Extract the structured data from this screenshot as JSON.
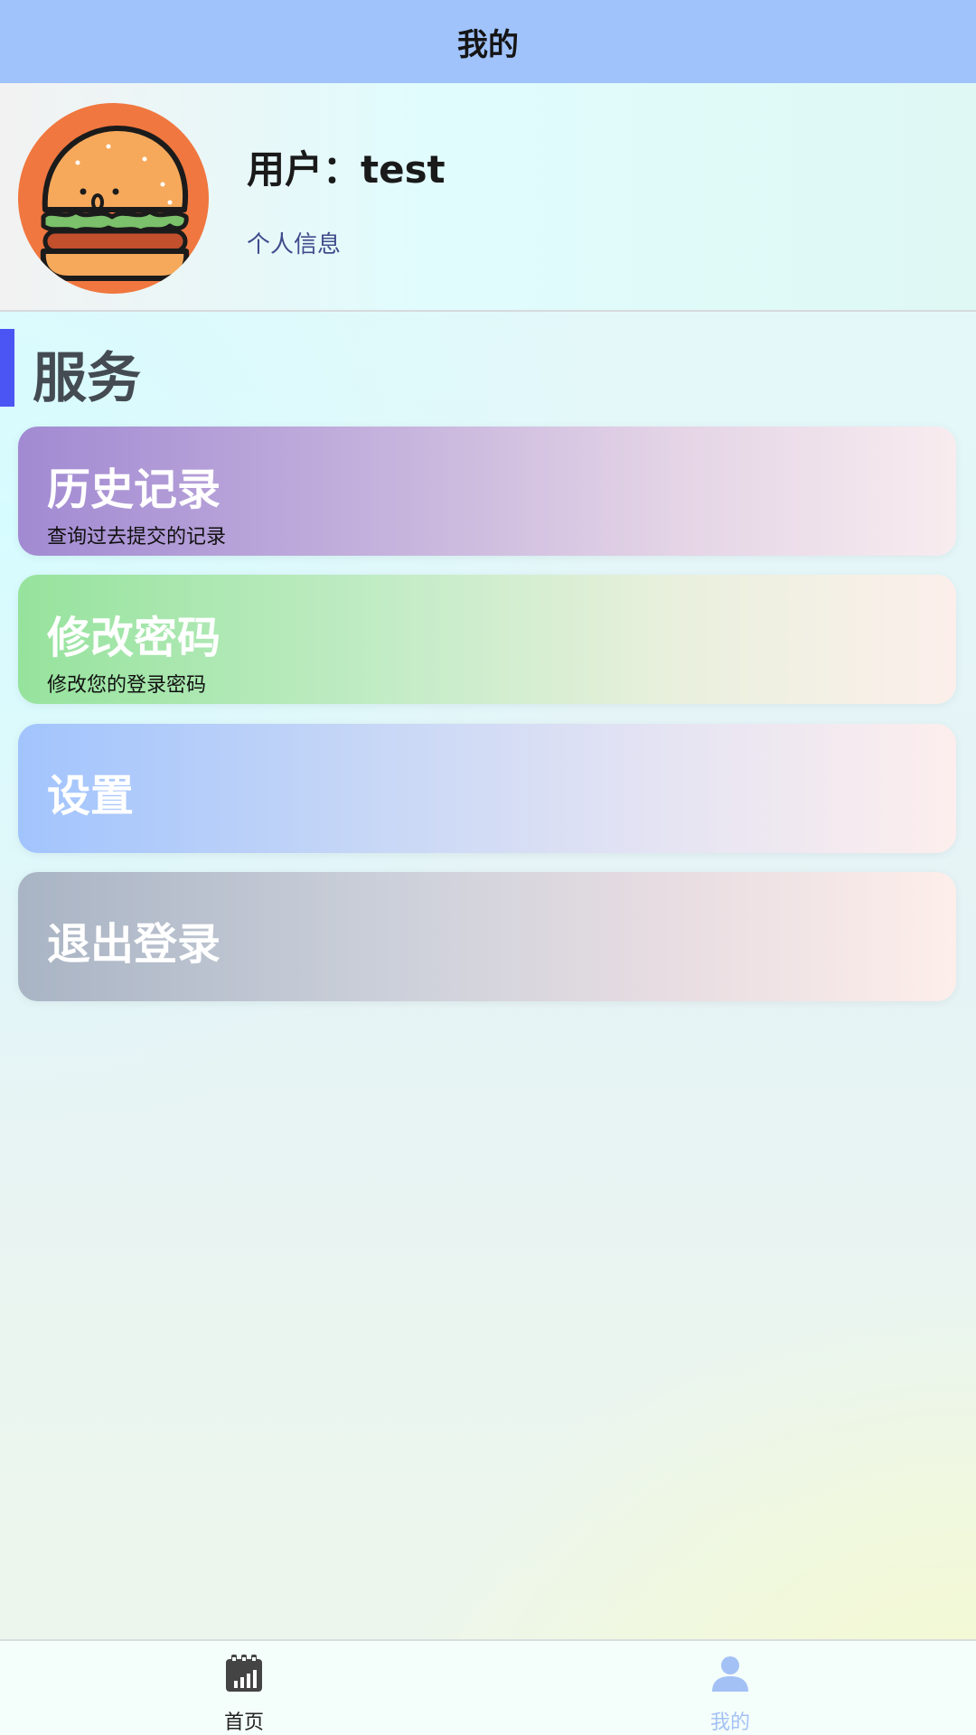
{
  "header": {
    "title": "我的"
  },
  "profile": {
    "username": "用户：test",
    "info_link": "个人信息",
    "avatar_icon": "burger-avatar"
  },
  "section": {
    "title": "服务",
    "accent_color": "#4b55f4"
  },
  "cards": [
    {
      "title": "历史记录",
      "subtitle": "查询过去提交的记录"
    },
    {
      "title": "修改密码",
      "subtitle": "修改您的登录密码"
    },
    {
      "title": "设置"
    },
    {
      "title": "退出登录"
    }
  ],
  "tabbar": {
    "tabs": [
      {
        "label": "首页",
        "icon": "chart-calendar-icon",
        "active": false
      },
      {
        "label": "我的",
        "icon": "user-icon",
        "active": true
      }
    ],
    "active_color": "#a3c1f5"
  },
  "colors": {
    "header_bg": "#a0c3fc"
  }
}
